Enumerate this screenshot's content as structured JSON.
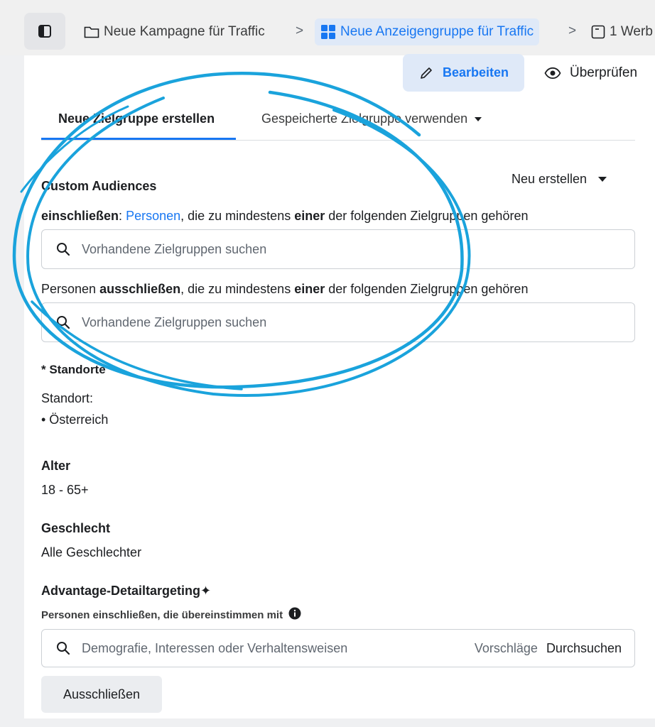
{
  "breadcrumb": {
    "items": [
      {
        "label": "Neue Kampagne für Traffic"
      },
      {
        "label": "Neue Anzeigengruppe für Traffic"
      },
      {
        "label": "1 Werb"
      }
    ],
    "separator": ">"
  },
  "actions": {
    "edit_label": "Bearbeiten",
    "review_label": "Überprüfen"
  },
  "tabs": [
    {
      "label": "Neue Zielgruppe erstellen",
      "active": true
    },
    {
      "label": "Gespeicherte Zielgruppe verwenden"
    }
  ],
  "custom_audiences": {
    "title": "Custom Audiences",
    "new_label": "Neu erstellen",
    "include_prefix": "einschließen",
    "include_colon": ": ",
    "include_link": "Personen",
    "include_mid": ", die zu mindestens ",
    "include_bold": "einer",
    "include_suffix": " der folgenden Zielgruppen gehören",
    "exclude_prefix": "Personen ",
    "exclude_bold": "ausschließen",
    "exclude_mid": ", die zu mindestens ",
    "exclude_bold2": "einer",
    "exclude_suffix": " der folgenden Zielgruppen gehören",
    "search_placeholder_1": "Vorhandene Zielgruppen suchen",
    "search_placeholder_2": "Vorhandene Zielgruppen suchen"
  },
  "locations": {
    "title": "* Standorte",
    "label": "Standort:",
    "items": [
      "• Österreich"
    ]
  },
  "age": {
    "title": "Alter",
    "value": "18 - 65+"
  },
  "gender": {
    "title": "Geschlecht",
    "value": "Alle Geschlechter"
  },
  "detail_targeting": {
    "title": "Advantage-Detailtargeting",
    "sparkle": "✦",
    "subtitle": "Personen einschließen, die übereinstimmen mit",
    "placeholder": "Demografie, Interessen oder Verhaltensweisen",
    "suggestions": "Vorschläge",
    "browse": "Durchsuchen",
    "exclude_button": "Ausschließen"
  },
  "colors": {
    "accent": "#1877f2",
    "annotation_circle": "#1aa3dc"
  }
}
